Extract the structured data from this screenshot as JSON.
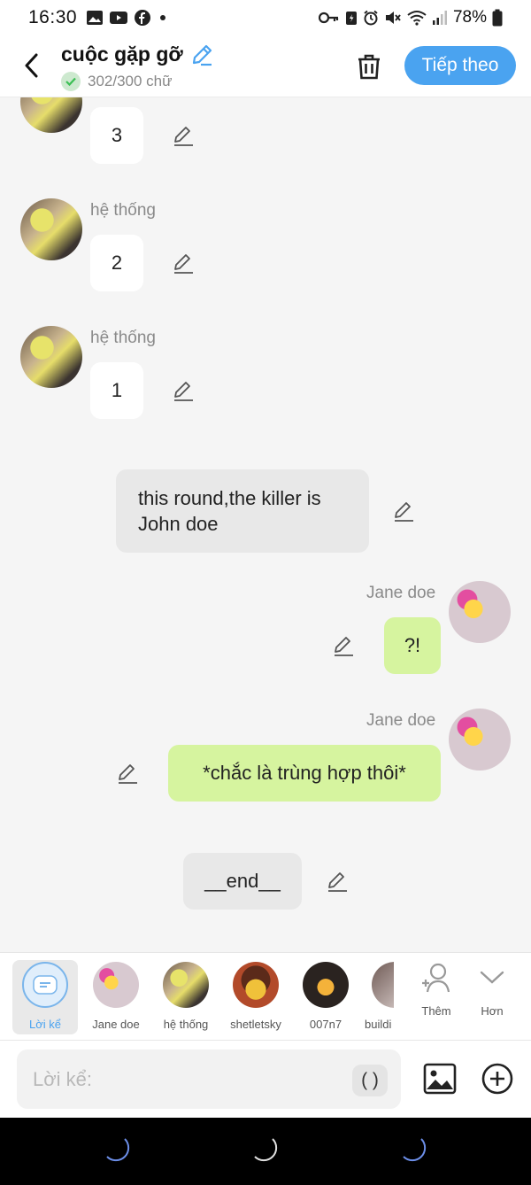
{
  "status_bar": {
    "time": "16:30",
    "battery": "78%"
  },
  "header": {
    "title": "cuộc gặp gỡ",
    "word_count": "302/300 chữ",
    "next_label": "Tiếp theo"
  },
  "messages": [
    {
      "sender": "",
      "text": "3"
    },
    {
      "sender": "hệ thống",
      "text": "2"
    },
    {
      "sender": "hệ thống",
      "text": "1"
    },
    {
      "sender": "",
      "text": "this round,the killer is John doe"
    },
    {
      "sender": "Jane doe",
      "text": "?!"
    },
    {
      "sender": "Jane doe",
      "text": "*chắc là trùng hợp thôi*"
    },
    {
      "sender": "",
      "text": "__end__"
    }
  ],
  "characters": [
    {
      "label": "Lời kể",
      "icon": "narration-icon"
    },
    {
      "label": "Jane doe"
    },
    {
      "label": "hệ thống"
    },
    {
      "label": "shetletsky"
    },
    {
      "label": "007n7"
    },
    {
      "label": "buildi"
    },
    {
      "label": "Thêm",
      "icon": "add-person-icon"
    },
    {
      "label": "Hơn",
      "icon": "chevron-down-icon"
    }
  ],
  "input": {
    "placeholder": "Lời kể:",
    "paren_label": "( )"
  },
  "colors": {
    "accent": "#4aa3f0",
    "user_bubble": "#d6f49f",
    "narration_bubble": "#e8e8e8",
    "system_bubble": "#ffffff"
  }
}
